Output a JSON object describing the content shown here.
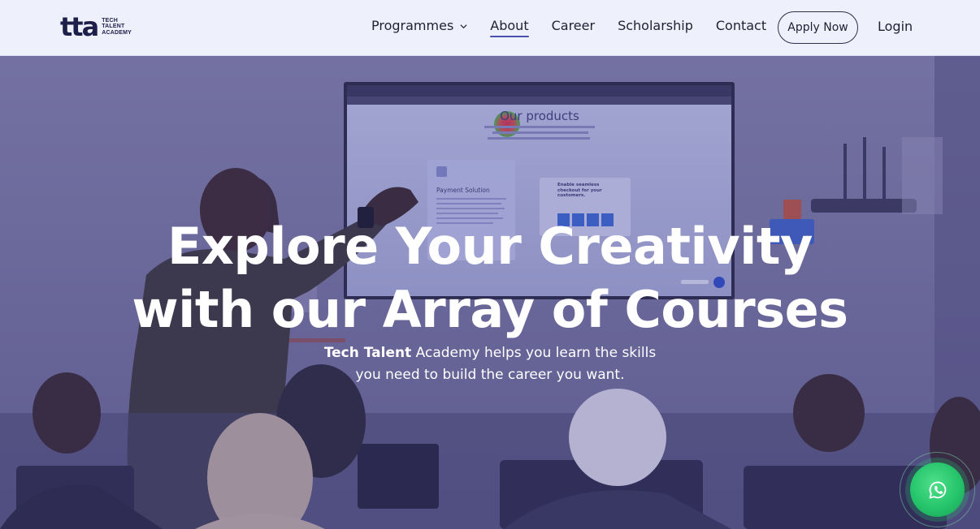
{
  "brand": {
    "logo_mark": "tta",
    "logo_line1": "TECH",
    "logo_line2": "TALENT",
    "logo_line3": "ACADEMY"
  },
  "nav": {
    "items": [
      {
        "label": "Programmes",
        "has_dropdown": true,
        "active": false
      },
      {
        "label": "About",
        "has_dropdown": false,
        "active": true
      },
      {
        "label": "Career",
        "has_dropdown": false,
        "active": false
      },
      {
        "label": "Scholarship",
        "has_dropdown": false,
        "active": false
      },
      {
        "label": "Contact",
        "has_dropdown": false,
        "active": false
      }
    ],
    "apply_label": "Apply Now",
    "login_label": "Login"
  },
  "hero": {
    "title_line1": "Explore Your Creativity",
    "title_line2": "with our Array of Courses",
    "sub_bold": "Tech Talent",
    "sub_rest": " Academy helps you learn the skills",
    "sub_line2": "you need to build the career you want.",
    "screen_heading": "Our products",
    "screen_card1": "Payment Solution",
    "screen_card2": "Enable seamless checkout for your customers."
  },
  "floating": {
    "whatsapp_icon": "whatsapp-icon"
  },
  "colors": {
    "nav_bg": "#eef0fb",
    "brand_dark": "#1d1f4a",
    "active_underline": "#4a4fb0",
    "whatsapp_green": "#25c46a"
  }
}
